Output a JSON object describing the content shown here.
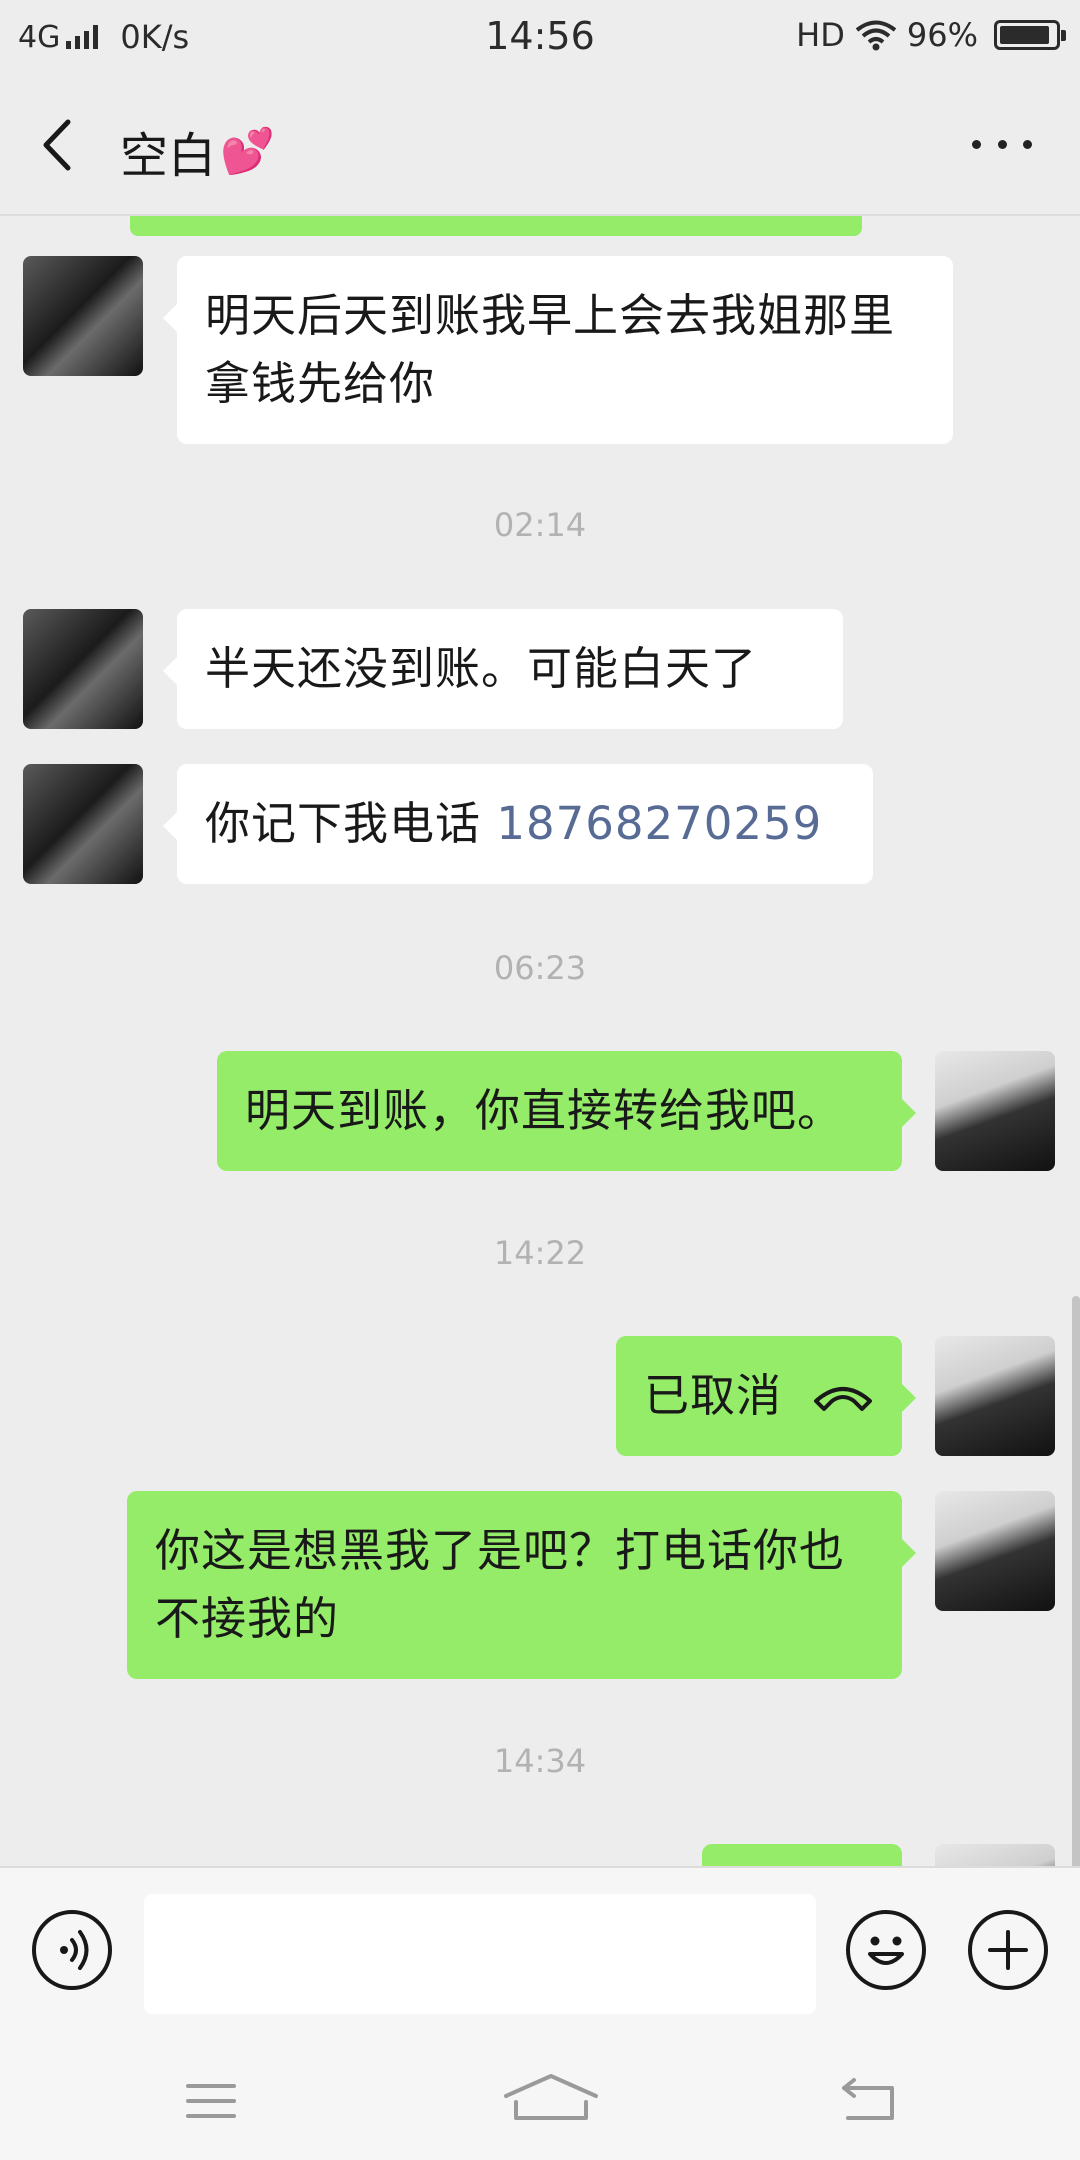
{
  "status_bar": {
    "network": "4G",
    "speed": "0K/s",
    "time": "14:56",
    "hd": "HD",
    "battery": "96%",
    "battery_level": 0.96
  },
  "header": {
    "title": "空白",
    "title_emoji": "💕"
  },
  "messages": [
    {
      "side": "other",
      "text": "明天后天到账我早上会去我姐那里拿钱先给你"
    },
    {
      "timestamp": "02:14"
    },
    {
      "side": "other",
      "text": "半天还没到账。可能白天了"
    },
    {
      "side": "other",
      "text_prefix": "你记下我电话 ",
      "phone": "18768270259"
    },
    {
      "timestamp": "06:23"
    },
    {
      "side": "mine",
      "text": "明天到账，你直接转给我吧。"
    },
    {
      "timestamp": "14:22"
    },
    {
      "side": "mine",
      "text": "已取消",
      "icon": "phone-hangup-icon"
    },
    {
      "side": "mine",
      "text": "你这是想黑我了是吧？打电话你也不接我的"
    },
    {
      "timestamp": "14:34"
    }
  ],
  "colors": {
    "background": "#ededed",
    "bubble_mine": "#95ec69",
    "bubble_other": "#ffffff",
    "link": "#576b95",
    "timestamp": "#b2b2b2"
  },
  "input": {
    "value": ""
  }
}
